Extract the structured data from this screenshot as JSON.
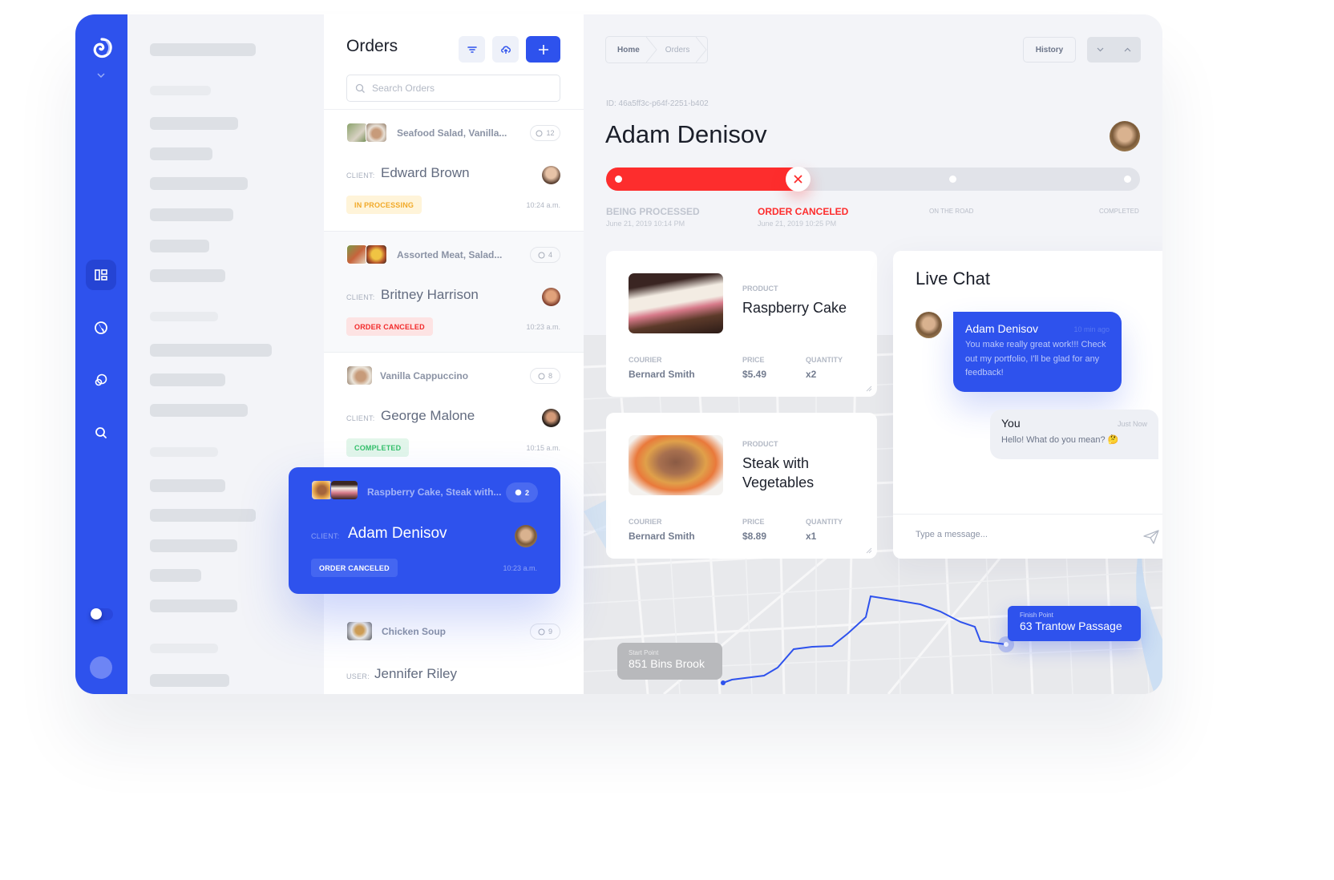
{
  "colors": {
    "accent": "#2e52ed",
    "danger": "#fd2d2d",
    "processing_bg": "#fff4d9",
    "processing_fg": "#f1a928",
    "canceled_bg": "#fde3e3",
    "canceled_fg": "#f22a2a",
    "completed_bg": "#e2f6ea",
    "completed_fg": "#35c06b"
  },
  "rail": {
    "icons": [
      "logo-icon",
      "dashboard-icon",
      "globe-icon",
      "chat-icon",
      "search-icon"
    ],
    "theme_toggle_on": false
  },
  "orders": {
    "title": "Orders",
    "search_placeholder": "Search Orders",
    "client_label": "CLIENT:",
    "user_label": "USER:",
    "list": [
      {
        "items": "Seafood Salad, Vanilla...",
        "comments": "12",
        "client": "Edward Brown",
        "status": "IN PROCESSING",
        "status_kind": "processing",
        "time": "10:24 a.m."
      },
      {
        "items": "Assorted Meat, Salad...",
        "comments": "4",
        "client": "Britney Harrison",
        "status": "ORDER CANCELED",
        "status_kind": "canceled",
        "time": "10:23 a.m."
      },
      {
        "items": "Vanilla Cappuccino",
        "comments": "8",
        "client": "George Malone",
        "status": "COMPLETED",
        "status_kind": "completed",
        "time": "10:15 a.m."
      },
      {
        "items": "Chicken Soup",
        "comments": "9",
        "client": "Jennifer Riley"
      }
    ],
    "active": {
      "items": "Raspberry Cake, Steak with...",
      "comments": "2",
      "client": "Adam Denisov",
      "status": "ORDER CANCELED",
      "time": "10:23 a.m."
    }
  },
  "header": {
    "breadcrumb": [
      "Home",
      "Orders"
    ],
    "history_label": "History"
  },
  "order_detail": {
    "id": "ID: 46a5ff3c-p64f-2251-b402",
    "client_name": "Adam Denisov",
    "progress_fraction": 0.36,
    "stages": [
      {
        "label": "BEING PROCESSED",
        "date": "June 21, 2019 10:14 PM"
      },
      {
        "label": "ORDER CANCELED",
        "date": "June 21, 2019 10:25 PM"
      },
      {
        "label": "ON THE ROAD"
      },
      {
        "label": "COMPLETED"
      }
    ]
  },
  "products": [
    {
      "label": "PRODUCT",
      "name": "Raspberry Cake",
      "courier_label": "COURIER",
      "courier": "Bernard Smith",
      "price_label": "PRICE",
      "price": "$5.49",
      "qty_label": "QUANTITY",
      "qty": "x2"
    },
    {
      "label": "PRODUCT",
      "name": "Steak with Vegetables",
      "courier_label": "COURIER",
      "courier": "Bernard Smith",
      "price_label": "PRICE",
      "price": "$8.89",
      "qty_label": "QUANTITY",
      "qty": "x1"
    }
  ],
  "chat": {
    "title": "Live Chat",
    "messages": [
      {
        "author": "Adam Denisov",
        "time": "10 min ago",
        "text": "You make really great work!!! Check out my portfolio, I'll be glad for any feedback!"
      },
      {
        "author": "You",
        "time": "Just Now",
        "text": "Hello! What do you mean? 🤔"
      }
    ],
    "input_placeholder": "Type a message..."
  },
  "map": {
    "start_caption": "Start Point",
    "start_address": "851 Bins Brook",
    "finish_caption": "Finish Point",
    "finish_address": "63 Trantow Passage"
  }
}
